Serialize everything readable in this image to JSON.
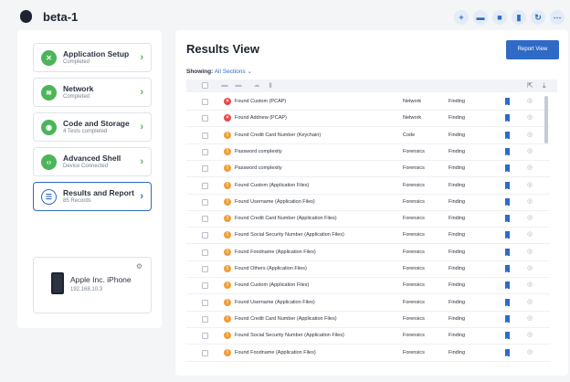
{
  "header": {
    "logo_glyph": "",
    "project": "beta-1",
    "actions": [
      {
        "icon": "plus-icon",
        "glyph": "+"
      },
      {
        "icon": "folder-icon",
        "glyph": "▬"
      },
      {
        "icon": "note-icon",
        "glyph": "■"
      },
      {
        "icon": "trash-icon",
        "glyph": "▮"
      },
      {
        "icon": "refresh-icon",
        "glyph": "↻"
      },
      {
        "icon": "more-icon",
        "glyph": "⋯"
      }
    ]
  },
  "steps": [
    {
      "title": "Application Setup",
      "sub": "Completed",
      "icon": "app-setup-icon",
      "glyph": "✕"
    },
    {
      "title": "Network",
      "sub": "Completed",
      "icon": "wifi-icon",
      "glyph": "≋"
    },
    {
      "title": "Code and Storage",
      "sub": "4 Tests completed",
      "icon": "storage-icon",
      "glyph": "◉"
    },
    {
      "title": "Advanced Shell",
      "sub": "Device Connected",
      "icon": "shell-icon",
      "glyph": "‹›"
    },
    {
      "title": "Results and Report",
      "sub": "85 Records",
      "icon": "list-icon",
      "glyph": "☰",
      "active": true
    }
  ],
  "device": {
    "name": "Apple Inc. iPhone",
    "ip": "192.168.10.3",
    "gear_glyph": "⚙"
  },
  "results": {
    "title": "Results View",
    "report_button": "Report View",
    "showing_label": "Showing:",
    "showing_value": "All Sections ⌄"
  },
  "toolbar_glyphs": {
    "export": "⇱",
    "download": "⤓"
  },
  "colors": {
    "accent": "#2f6bc6",
    "success": "#4bb559",
    "high": "#e5484d",
    "medium": "#f09d38"
  },
  "rows": [
    {
      "severity": "high",
      "name": "Found Custom (PCAP)",
      "category": "Network",
      "type": "Finding"
    },
    {
      "severity": "high",
      "name": "Found Addnew (PCAP)",
      "category": "Network",
      "type": "Finding"
    },
    {
      "severity": "med",
      "name": "Found Credit Card Number (Keychain)",
      "category": "Code",
      "type": "Finding"
    },
    {
      "severity": "med",
      "name": "Password complexity",
      "category": "Forensics",
      "type": "Finding"
    },
    {
      "severity": "med",
      "name": "Password complexity",
      "category": "Forensics",
      "type": "Finding"
    },
    {
      "severity": "med",
      "name": "Found Custom (Application Files)",
      "category": "Forensics",
      "type": "Finding"
    },
    {
      "severity": "med",
      "name": "Found Username (Application Files)",
      "category": "Forensics",
      "type": "Finding"
    },
    {
      "severity": "med",
      "name": "Found Credit Card Number (Application Files)",
      "category": "Forensics",
      "type": "Finding"
    },
    {
      "severity": "med",
      "name": "Found Social Security Number (Application Files)",
      "category": "Forensics",
      "type": "Finding"
    },
    {
      "severity": "med",
      "name": "Found Foodname (Application Files)",
      "category": "Forensics",
      "type": "Finding"
    },
    {
      "severity": "med",
      "name": "Found Others (Application Files)",
      "category": "Forensics",
      "type": "Finding"
    },
    {
      "severity": "med",
      "name": "Found Custom (Application Files)",
      "category": "Forensics",
      "type": "Finding"
    },
    {
      "severity": "med",
      "name": "Found Username (Application Files)",
      "category": "Forensics",
      "type": "Finding"
    },
    {
      "severity": "med",
      "name": "Found Credit Card Number (Application Files)",
      "category": "Forensics",
      "type": "Finding"
    },
    {
      "severity": "med",
      "name": "Found Social Security Number (Application Files)",
      "category": "Forensics",
      "type": "Finding"
    },
    {
      "severity": "med",
      "name": "Found Foodname (Application Files)",
      "category": "Forensics",
      "type": "Finding"
    }
  ]
}
